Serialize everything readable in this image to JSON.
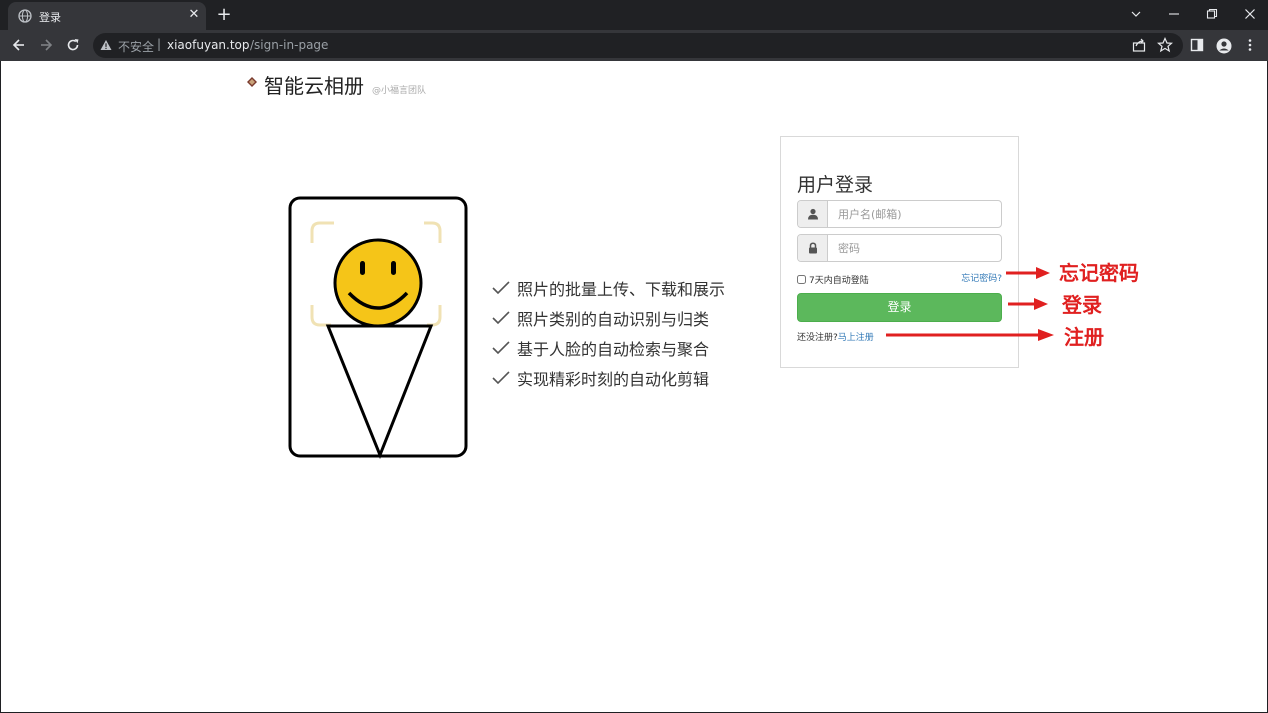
{
  "browser": {
    "tab_title": "登录",
    "tab_close": "✕",
    "new_tab": "+",
    "security_label": "不安全",
    "url_separator": "|",
    "url_host": "xiaofuyan.top",
    "url_path": "/sign-in-page"
  },
  "page": {
    "logo_title": "智能云相册",
    "logo_subtitle": "@小福言团队",
    "features": [
      "照片的批量上传、下载和展示",
      "照片类别的自动识别与归类",
      "基于人脸的自动检索与聚合",
      "实现精彩时刻的自动化剪辑"
    ]
  },
  "login": {
    "heading": "用户登录",
    "username_placeholder": "用户名(邮箱)",
    "password_placeholder": "密码",
    "remember_label": "7天内自动登陆",
    "forgot_link": "忘记密码?",
    "submit_label": "登录",
    "signup_prompt": "还没注册?",
    "signup_link": "马上注册"
  },
  "annotations": {
    "forgot": "忘记密码",
    "login": "登录",
    "register": "注册",
    "color": "#e02020"
  },
  "colors": {
    "chrome_dark": "#202124",
    "chrome_toolbar": "#35363a",
    "success_green": "#5cb85c",
    "link_blue": "#337ab7",
    "smiley_yellow": "#f5c518"
  }
}
